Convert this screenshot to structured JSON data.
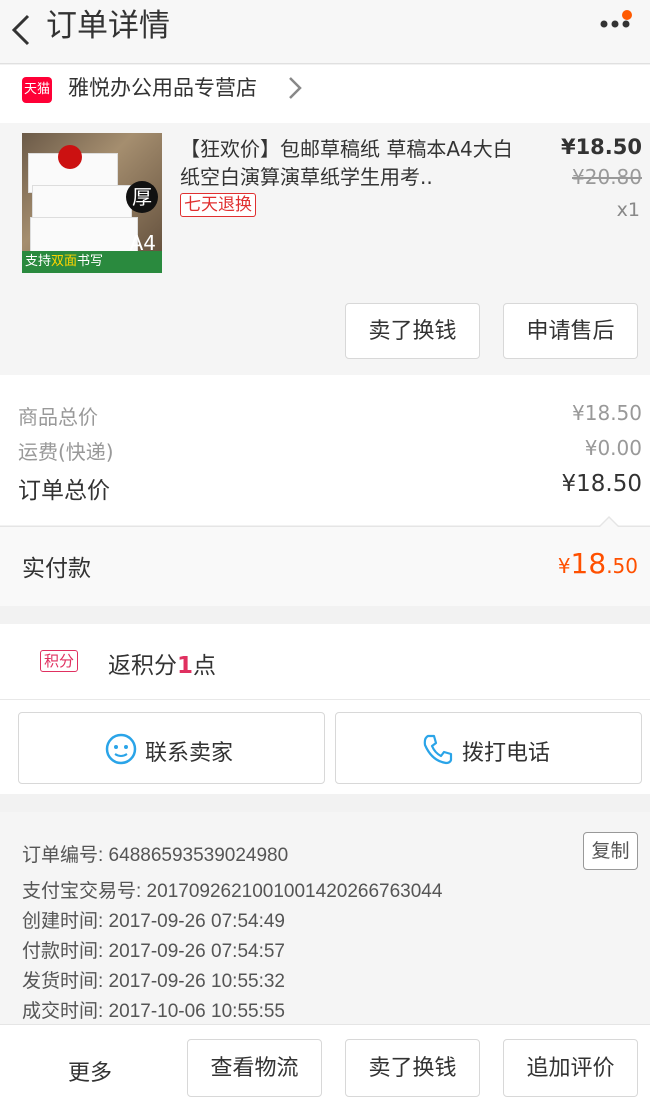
{
  "header": {
    "title": "订单详情",
    "back_icon": "chevron-left-icon",
    "more_icon": "more-dots-icon"
  },
  "shop": {
    "badge": "天猫",
    "name": "雅悦办公用品专营店"
  },
  "product": {
    "title": "【狂欢价】包邮草稿纸 草稿本A4大白纸空白演算演草纸学生用考..",
    "tag": "七天退换",
    "price": "¥18.50",
    "original_price": "¥20.80",
    "quantity": "x1",
    "thumb_badge": "厚",
    "thumb_size": "A4",
    "thumb_caption_1": "支持",
    "thumb_caption_2": "双面",
    "thumb_caption_3": "书写",
    "sell_button": "卖了换钱",
    "after_sale_button": "申请售后"
  },
  "summary": {
    "goods_label": "商品总价",
    "goods_value": "¥18.50",
    "shipping_label": "运费(快递)",
    "shipping_value": "¥0.00",
    "total_label": "订单总价",
    "total_value": "¥18.50"
  },
  "paid": {
    "label": "实付款",
    "currency": "¥",
    "integer": "18",
    "decimal": ".50"
  },
  "points": {
    "tag": "积分",
    "prefix": "返积分",
    "count": "1",
    "suffix": "点"
  },
  "contact": {
    "seller_label": "联系卖家",
    "call_label": "拨打电话"
  },
  "order_info": {
    "copy_label": "复制",
    "lines": [
      "订单编号: 64886593539024980",
      "支付宝交易号: 2017092621001001420266763044",
      "创建时间: 2017-09-26 07:54:49",
      "付款时间: 2017-09-26 07:54:57",
      "发货时间: 2017-09-26 10:55:32",
      "成交时间: 2017-10-06 10:55:55"
    ]
  },
  "footer": {
    "more": "更多",
    "logistics": "查看物流",
    "sell": "卖了换钱",
    "review": "追加评价"
  },
  "colors": {
    "accent": "#ff5000",
    "tmall_red": "#ff0036",
    "points_pink": "#e03060"
  }
}
